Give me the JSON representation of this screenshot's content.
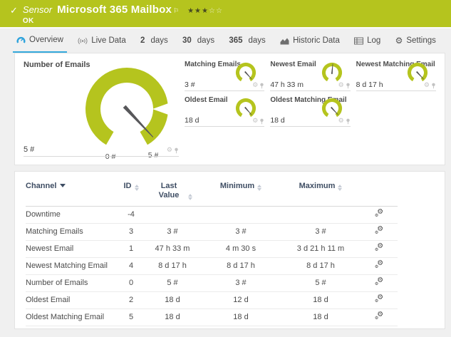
{
  "colors": {
    "accent": "#b5c41e",
    "active_tab": "#35aadc"
  },
  "header": {
    "check": "✓",
    "kind": "Sensor",
    "title": "Microsoft 365 Mailbox",
    "flag": "⚐",
    "stars_filled": "★★★",
    "stars_empty": "☆☆",
    "status": "OK"
  },
  "tabs": {
    "items": [
      {
        "label": "Overview"
      },
      {
        "label": "Live Data"
      },
      {
        "num": "2",
        "label": "days"
      },
      {
        "num": "30",
        "label": "days"
      },
      {
        "num": "365",
        "label": "days"
      },
      {
        "label": "Historic Data"
      },
      {
        "label": "Log"
      },
      {
        "label": "Settings"
      }
    ],
    "settings_gear": "⚙"
  },
  "icon_glyphs": {
    "tile_gear": "⚙",
    "row_gear": "⚙"
  },
  "gauges": {
    "number_of_emails": {
      "title": "Number of Emails",
      "value": "5 #",
      "scale_min": "0 #",
      "scale_max": "5 #",
      "needle_deg": 137
    },
    "matching_emails": {
      "title": "Matching Emails",
      "value": "3 #",
      "needle_deg": 138
    },
    "newest_email": {
      "title": "Newest Email",
      "value": "47 h 33 m",
      "needle_deg": 5
    },
    "newest_matching_email": {
      "title": "Newest Matching Email",
      "value": "8 d 17 h",
      "needle_deg": 137
    },
    "oldest_email": {
      "title": "Oldest Email",
      "value": "18 d",
      "needle_deg": 139
    },
    "oldest_matching_email": {
      "title": "Oldest Matching Email",
      "value": "18 d",
      "needle_deg": 137
    }
  },
  "table": {
    "columns": {
      "channel": "Channel",
      "id": "ID",
      "last_value": "Last Value",
      "minimum": "Minimum",
      "maximum": "Maximum"
    },
    "rows": [
      {
        "channel": "Downtime",
        "id": "-4",
        "last": "",
        "min": "",
        "max": ""
      },
      {
        "channel": "Matching Emails",
        "id": "3",
        "last": "3 #",
        "min": "3 #",
        "max": "3 #"
      },
      {
        "channel": "Newest Email",
        "id": "1",
        "last": "47 h 33 m",
        "min": "4 m 30 s",
        "max": "3 d 21 h 11 m"
      },
      {
        "channel": "Newest Matching Email",
        "id": "4",
        "last": "8 d 17 h",
        "min": "8 d 17 h",
        "max": "8 d 17 h"
      },
      {
        "channel": "Number of Emails",
        "id": "0",
        "last": "5 #",
        "min": "3 #",
        "max": "5 #"
      },
      {
        "channel": "Oldest Email",
        "id": "2",
        "last": "18 d",
        "min": "12 d",
        "max": "18 d"
      },
      {
        "channel": "Oldest Matching Email",
        "id": "5",
        "last": "18 d",
        "min": "18 d",
        "max": "18 d"
      }
    ]
  }
}
